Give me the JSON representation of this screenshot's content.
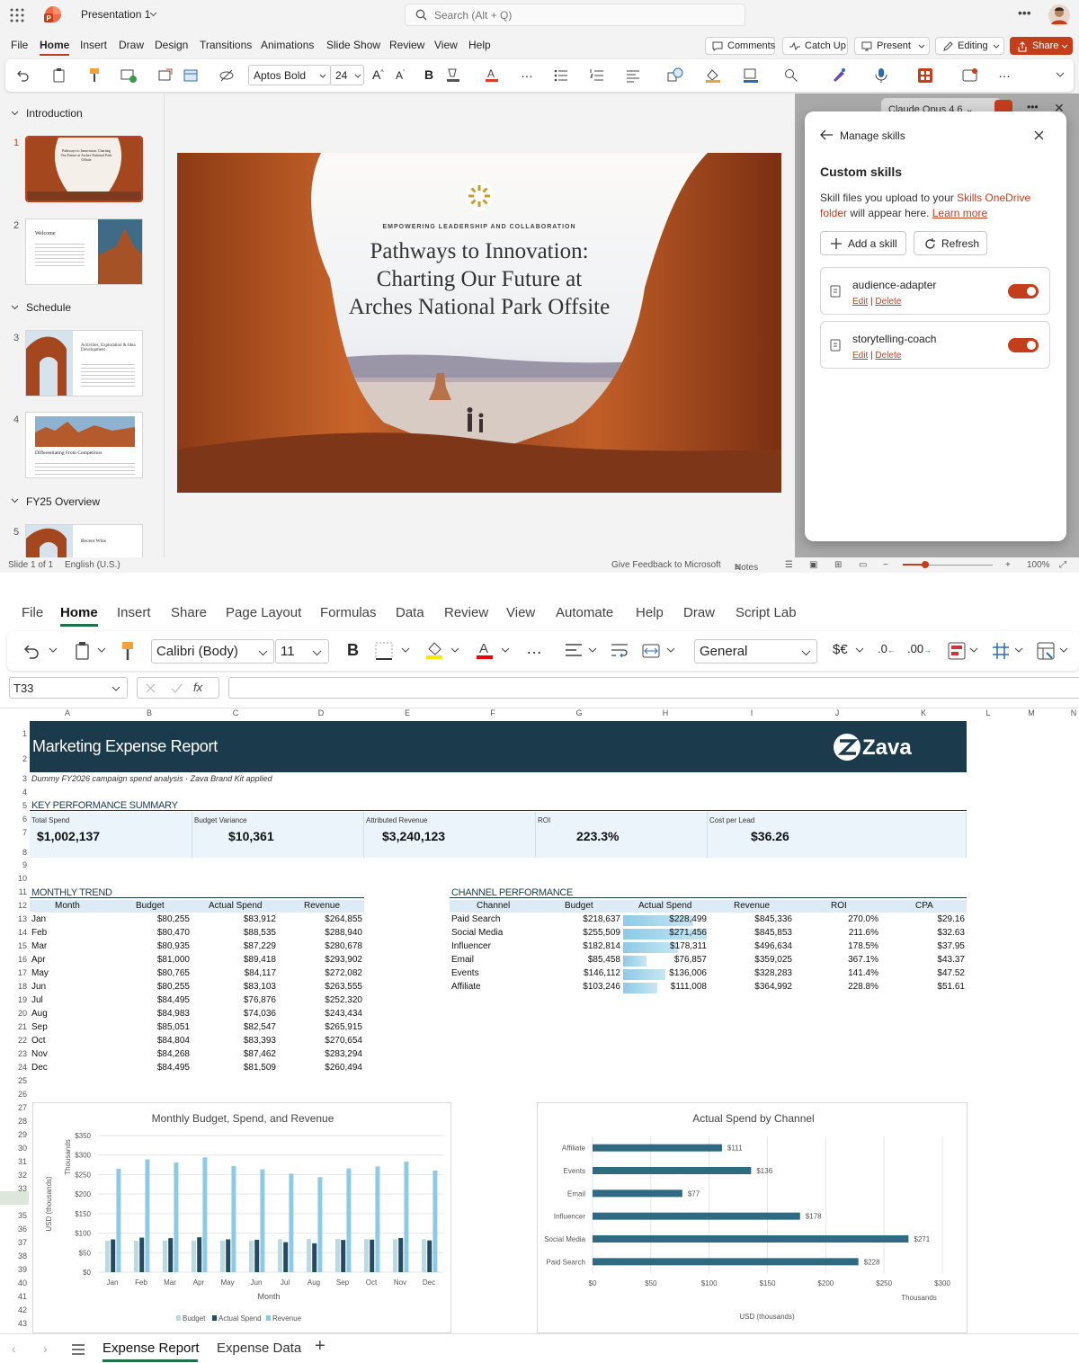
{
  "ppt": {
    "doc_title": "Presentation 1",
    "search_placeholder": "Search (Alt + Q)",
    "menu": [
      "File",
      "Home",
      "Insert",
      "Draw",
      "Design",
      "Transitions",
      "Animations",
      "Slide Show",
      "Review",
      "View",
      "Help"
    ],
    "buttons": {
      "comments": "Comments",
      "catchup": "Catch Up",
      "present": "Present",
      "editing": "Editing",
      "share": "Share"
    },
    "font_name": "Aptos Bold",
    "font_size": "24",
    "sections": [
      "Introduction",
      "Schedule",
      "FY25 Overview"
    ],
    "thumb_numbers": [
      "1",
      "2",
      "3",
      "4",
      "5"
    ],
    "thumbs": {
      "t1": "Pathways to Innovation: Charting Our Future at Arches National Park Offsite",
      "t2": "Welcome",
      "t3": "Activities, Exploration & Idea Development",
      "t4": "Differentiating From Competitors",
      "t5": "Recent Wins"
    },
    "slide": {
      "kicker": "EMPOWERING LEADERSHIP AND COLLABORATION",
      "title_line1": "Pathways to Innovation:",
      "title_line2": "Charting Our Future at",
      "title_line3": "Arches National Park Offsite"
    },
    "model_selector": "Claude Opus 4.6",
    "skills_panel": {
      "back_label": "Manage skills",
      "heading": "Custom skills",
      "desc_part1": "Skill files you upload to your ",
      "desc_link1": "Skills OneDrive",
      "desc_link1b": "folder",
      "desc_part2": " will appear here. ",
      "desc_link2": "Learn more",
      "add_label": "Add a skill",
      "refresh_label": "Refresh",
      "edit_label": "Edit",
      "sep": "|",
      "delete_label": "Delete",
      "skills": [
        {
          "name": "audience-adapter",
          "enabled": true
        },
        {
          "name": "storytelling-coach",
          "enabled": true
        }
      ]
    },
    "status": {
      "slide": "Slide 1 of 1",
      "lang": "English (U.S.)",
      "feedback": "Give Feedback to Microsoft",
      "notes": "Notes",
      "zoom": "100%"
    }
  },
  "xl": {
    "menu": [
      "File",
      "Home",
      "Insert",
      "Share",
      "Page Layout",
      "Formulas",
      "Data",
      "Review",
      "View",
      "Automate",
      "Help",
      "Draw",
      "Script Lab"
    ],
    "font_name": "Calibri (Body)",
    "font_size": "11",
    "number_format": "General",
    "name_box": "T33",
    "fx_label": "fx",
    "columns": [
      "A",
      "B",
      "C",
      "D",
      "E",
      "F",
      "G",
      "H",
      "I",
      "J",
      "K",
      "L",
      "M",
      "N"
    ],
    "rows": [
      "1",
      "2",
      "3",
      "4",
      "5",
      "6",
      "7",
      "8",
      "9",
      "10",
      "11",
      "12",
      "13",
      "14",
      "15",
      "16",
      "17",
      "18",
      "19",
      "20",
      "21",
      "22",
      "23",
      "24",
      "25",
      "26",
      "27",
      "28",
      "29",
      "30",
      "31",
      "32",
      "33",
      "34",
      "35",
      "36",
      "37",
      "38",
      "39",
      "40",
      "41",
      "42",
      "43"
    ],
    "report_title": "Marketing Expense Report",
    "brand": "Zava",
    "subtitle": "Dummy FY2026 campaign spend analysis · Zava Brand Kit applied",
    "kpi_heading": "KEY PERFORMANCE SUMMARY",
    "kpis": [
      {
        "label": "Total Spend",
        "value": "$1,002,137"
      },
      {
        "label": "Budget Variance",
        "value": "$10,361"
      },
      {
        "label": "Attributed Revenue",
        "value": "$3,240,123"
      },
      {
        "label": "ROI",
        "value": "223.3%"
      },
      {
        "label": "Cost per Lead",
        "value": "$36.26"
      }
    ],
    "monthly_heading": "MONTHLY TREND",
    "monthly_headers": [
      "Month",
      "Budget",
      "Actual Spend",
      "Revenue"
    ],
    "monthly_rows": [
      [
        "Jan",
        "$80,255",
        "$83,912",
        "$264,855"
      ],
      [
        "Feb",
        "$80,470",
        "$88,535",
        "$288,940"
      ],
      [
        "Mar",
        "$80,935",
        "$87,229",
        "$280,678"
      ],
      [
        "Apr",
        "$81,000",
        "$89,418",
        "$293,902"
      ],
      [
        "May",
        "$80,765",
        "$84,117",
        "$272,082"
      ],
      [
        "Jun",
        "$80,255",
        "$83,103",
        "$263,555"
      ],
      [
        "Jul",
        "$84,495",
        "$76,876",
        "$252,320"
      ],
      [
        "Aug",
        "$84,983",
        "$74,036",
        "$243,434"
      ],
      [
        "Sep",
        "$85,051",
        "$82,547",
        "$265,915"
      ],
      [
        "Oct",
        "$84,804",
        "$83,393",
        "$270,654"
      ],
      [
        "Nov",
        "$84,268",
        "$87,462",
        "$283,294"
      ],
      [
        "Dec",
        "$84,495",
        "$81,509",
        "$260,494"
      ]
    ],
    "channel_heading": "CHANNEL PERFORMANCE",
    "channel_headers": [
      "Channel",
      "Budget",
      "Actual Spend",
      "Revenue",
      "ROI",
      "CPA"
    ],
    "channel_rows": [
      [
        "Paid Search",
        "$218,637",
        "$228,499",
        "$845,336",
        "270.0%",
        "$29.16"
      ],
      [
        "Social Media",
        "$255,509",
        "$271,456",
        "$845,853",
        "211.6%",
        "$32.63"
      ],
      [
        "Influencer",
        "$182,814",
        "$178,311",
        "$496,634",
        "178.5%",
        "$37.95"
      ],
      [
        "Email",
        "$85,458",
        "$76,857",
        "$359,025",
        "367.1%",
        "$43.37"
      ],
      [
        "Events",
        "$146,112",
        "$136,006",
        "$328,283",
        "141.4%",
        "$47.52"
      ],
      [
        "Affiliate",
        "$103,246",
        "$111,008",
        "$364,992",
        "228.8%",
        "$51.61"
      ]
    ],
    "databar_fraction": [
      0.84,
      1.0,
      0.66,
      0.28,
      0.5,
      0.41
    ],
    "sheet_tabs": [
      "Expense Report",
      "Expense Data"
    ],
    "colors": {
      "navy": "#1b3a4b",
      "teal": "#2e6b82",
      "light_blue": "#a9d3e6",
      "budget": "#bcd9e6",
      "accent_orange": "#c43e1c"
    }
  },
  "chart_data": [
    {
      "type": "bar",
      "title": "Monthly Budget, Spend, and Revenue",
      "xlabel": "Month",
      "ylabel": "USD (thousands)",
      "yunit": "Thousands",
      "categories": [
        "Jan",
        "Feb",
        "Mar",
        "Apr",
        "May",
        "Jun",
        "Jul",
        "Aug",
        "Sep",
        "Oct",
        "Nov",
        "Dec"
      ],
      "ylim": [
        0,
        350
      ],
      "yticks": [
        "$0",
        "$50",
        "$100",
        "$150",
        "$200",
        "$250",
        "$300",
        "$350"
      ],
      "legend": "bottom",
      "series": [
        {
          "name": "Budget",
          "color": "#bcd9e6",
          "values": [
            80.3,
            80.5,
            80.9,
            81.0,
            80.8,
            80.3,
            84.5,
            85.0,
            85.1,
            84.8,
            84.3,
            84.5
          ]
        },
        {
          "name": "Actual Spend",
          "color": "#1f4e62",
          "values": [
            83.9,
            88.5,
            87.2,
            89.4,
            84.1,
            83.1,
            76.9,
            74.0,
            82.5,
            83.4,
            87.5,
            81.5
          ]
        },
        {
          "name": "Revenue",
          "color": "#8ecae6",
          "values": [
            264.9,
            288.9,
            280.7,
            293.9,
            272.1,
            263.6,
            252.3,
            243.4,
            265.9,
            270.7,
            283.3,
            260.5
          ]
        }
      ]
    },
    {
      "type": "bar",
      "orientation": "horizontal",
      "title": "Actual Spend by Channel",
      "xlabel": "USD (thousands)",
      "xunit": "Thousands",
      "categories": [
        "Affiliate",
        "Events",
        "Email",
        "Influencer",
        "Social Media",
        "Paid Search"
      ],
      "values": [
        111,
        136,
        77,
        178,
        271,
        228
      ],
      "labels": [
        "$111",
        "$136",
        "$77",
        "$178",
        "$271",
        "$228"
      ],
      "xlim": [
        0,
        300
      ],
      "xticks": [
        "$0",
        "$50",
        "$100",
        "$150",
        "$200",
        "$250",
        "$300"
      ],
      "color": "#2e6b82"
    }
  ]
}
